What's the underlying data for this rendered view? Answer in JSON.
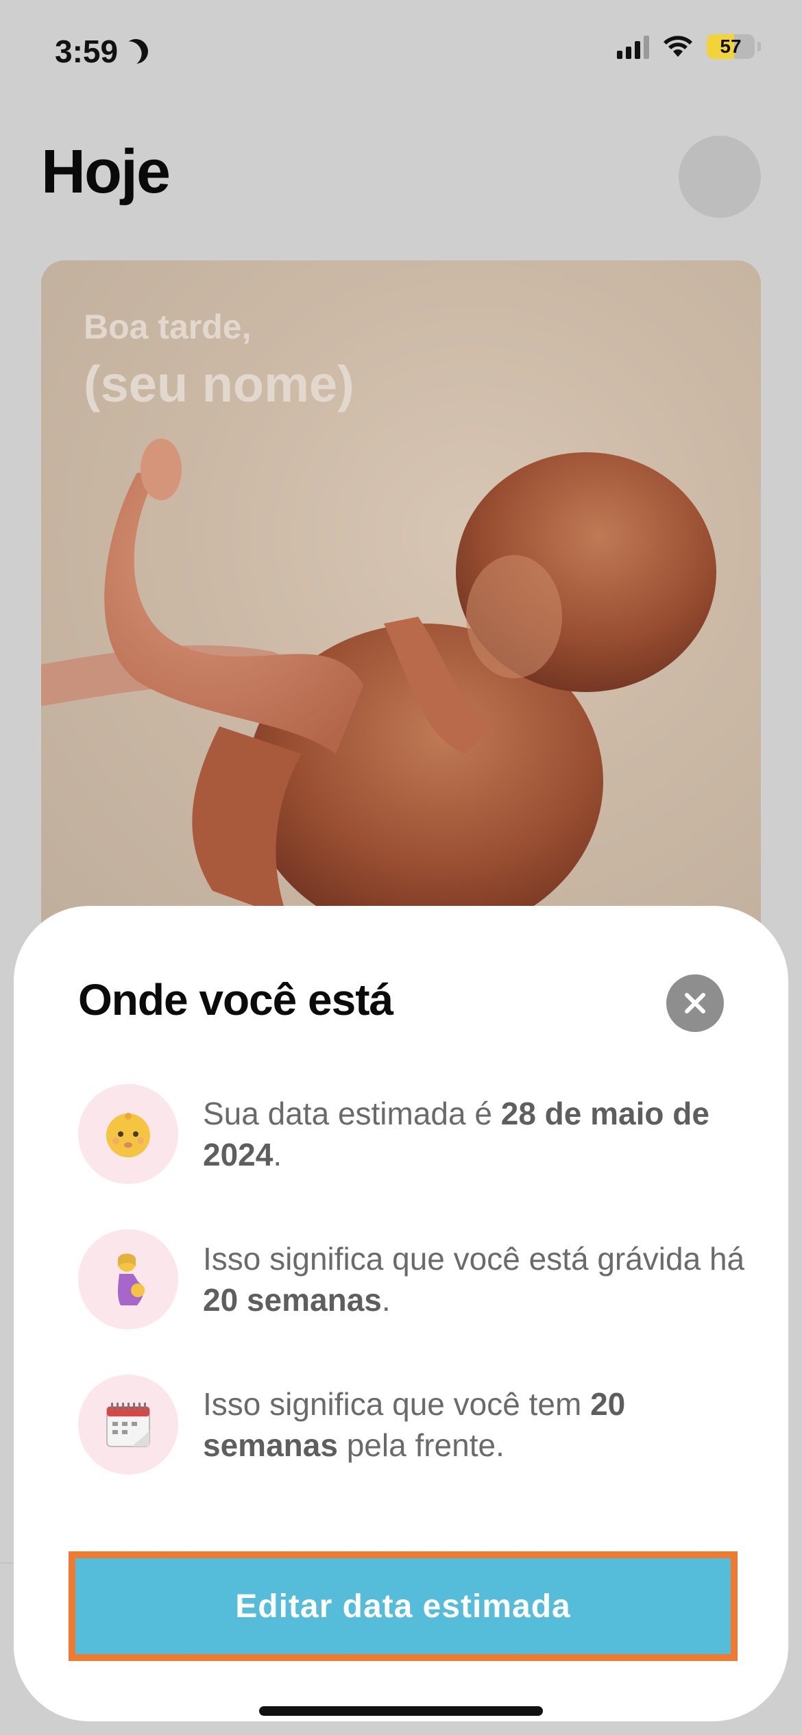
{
  "status_bar": {
    "time": "3:59",
    "battery_percent": "57",
    "battery_level": 0.57,
    "focus_icon": "moon-icon",
    "signal_icon": "cellular-signal-icon",
    "wifi_icon": "wifi-icon"
  },
  "header": {
    "title": "Hoje",
    "avatar_icon": "profile-avatar"
  },
  "hero": {
    "greeting": "Boa tarde,",
    "name": "(seu nome)",
    "image": "fetus-illustration"
  },
  "sheet": {
    "title": "Onde você está",
    "close_icon": "close-icon",
    "rows": [
      {
        "icon": "baby-face-icon",
        "text_before": "Sua data estimada é ",
        "bold": "28 de maio de 2024",
        "text_after": "."
      },
      {
        "icon": "pregnant-woman-icon",
        "text_before": "Isso significa que você está grávida há ",
        "bold": "20 semanas",
        "text_after": "."
      },
      {
        "icon": "calendar-icon",
        "text_before": "Isso significa que você tem ",
        "bold": "20 semanas",
        "text_after": " pela frente."
      }
    ],
    "button_label": "Editar data estimada"
  },
  "colors": {
    "accent_button": "#55bcd9",
    "highlight_border": "#ef7b32",
    "icon_bg": "#fbe6ec"
  }
}
